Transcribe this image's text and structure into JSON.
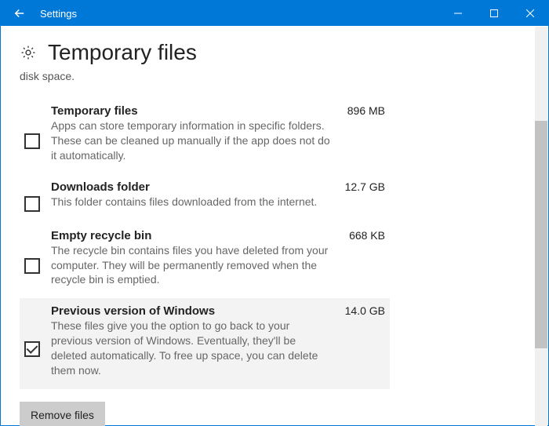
{
  "titlebar": {
    "appName": "Settings"
  },
  "page": {
    "heading": "Temporary files",
    "truncatedLine": "disk space."
  },
  "items": [
    {
      "label": "Temporary files",
      "size": "896 MB",
      "desc": "Apps can store temporary information in specific folders. These can be cleaned up manually if the app does not do it automatically.",
      "checked": false
    },
    {
      "label": "Downloads folder",
      "size": "12.7 GB",
      "desc": "This folder contains files downloaded from the internet.",
      "checked": false
    },
    {
      "label": "Empty recycle bin",
      "size": "668 KB",
      "desc": "The recycle bin contains files you have deleted from your computer. They will be permanently removed when the recycle bin is emptied.",
      "checked": false
    },
    {
      "label": "Previous version of Windows",
      "size": "14.0 GB",
      "desc": "These files give you the option to go back to your previous version of Windows. Eventually, they'll be deleted automatically. To free up space, you can delete them now.",
      "checked": true
    }
  ],
  "actions": {
    "removeFiles": "Remove files"
  }
}
